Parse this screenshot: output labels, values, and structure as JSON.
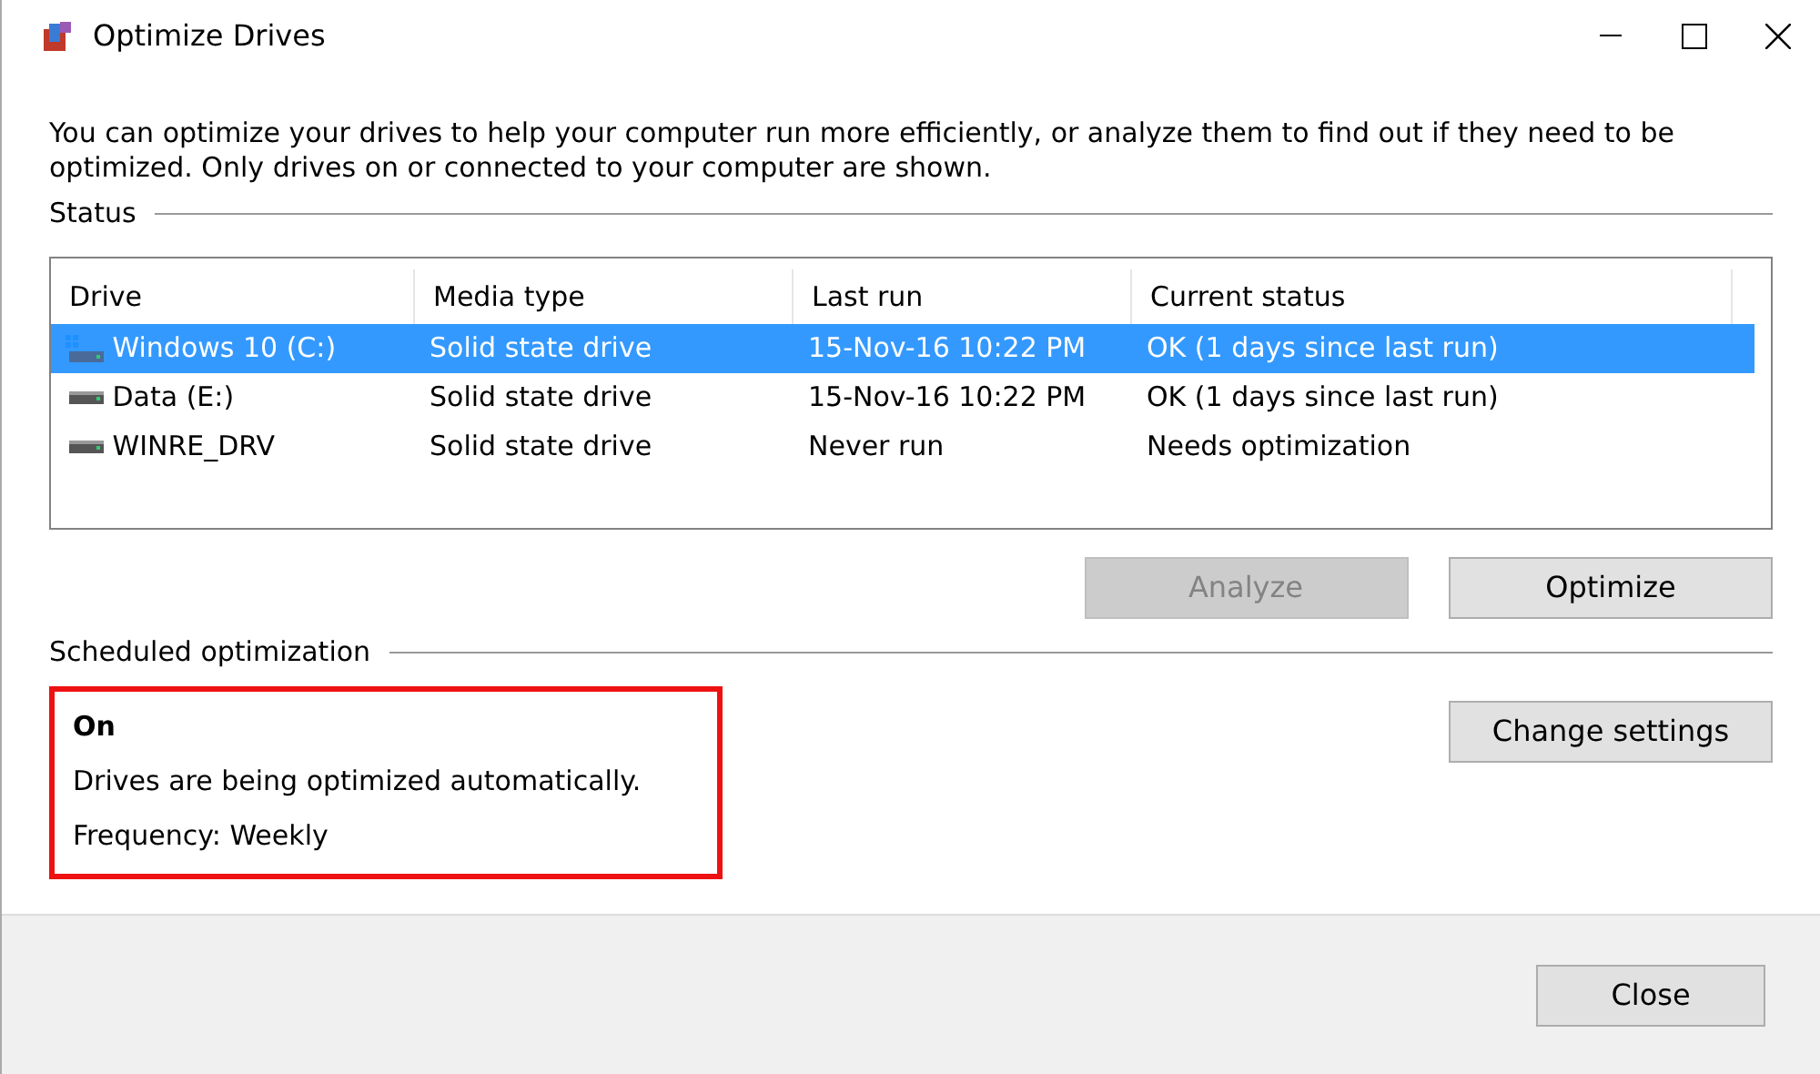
{
  "window": {
    "title": "Optimize Drives"
  },
  "description": "You can optimize your drives to help your computer run more efficiently, or analyze them to find out if they need to be optimized. Only drives on or connected to your computer are shown.",
  "status_label": "Status",
  "table": {
    "columns": [
      "Drive",
      "Media type",
      "Last run",
      "Current status"
    ],
    "rows": [
      {
        "kind": "system",
        "cells": [
          "Windows 10 (C:)",
          "Solid state drive",
          "15-Nov-16 10:22 PM",
          "OK (1 days since last run)"
        ],
        "selected": true
      },
      {
        "kind": "drive",
        "cells": [
          "Data (E:)",
          "Solid state drive",
          "15-Nov-16 10:22 PM",
          "OK (1 days since last run)"
        ],
        "selected": false
      },
      {
        "kind": "drive",
        "cells": [
          "WINRE_DRV",
          "Solid state drive",
          "Never run",
          "Needs optimization"
        ],
        "selected": false
      }
    ]
  },
  "actions": [
    {
      "label": "Analyze",
      "disabled": true
    },
    {
      "label": "Optimize",
      "disabled": false
    }
  ],
  "scheduled": {
    "label": "Scheduled optimization",
    "highlighted": true,
    "state": "On",
    "lines": [
      "Drives are being optimized automatically.",
      "Frequency: Weekly"
    ],
    "button": "Change settings"
  },
  "footer": {
    "button": "Close"
  }
}
